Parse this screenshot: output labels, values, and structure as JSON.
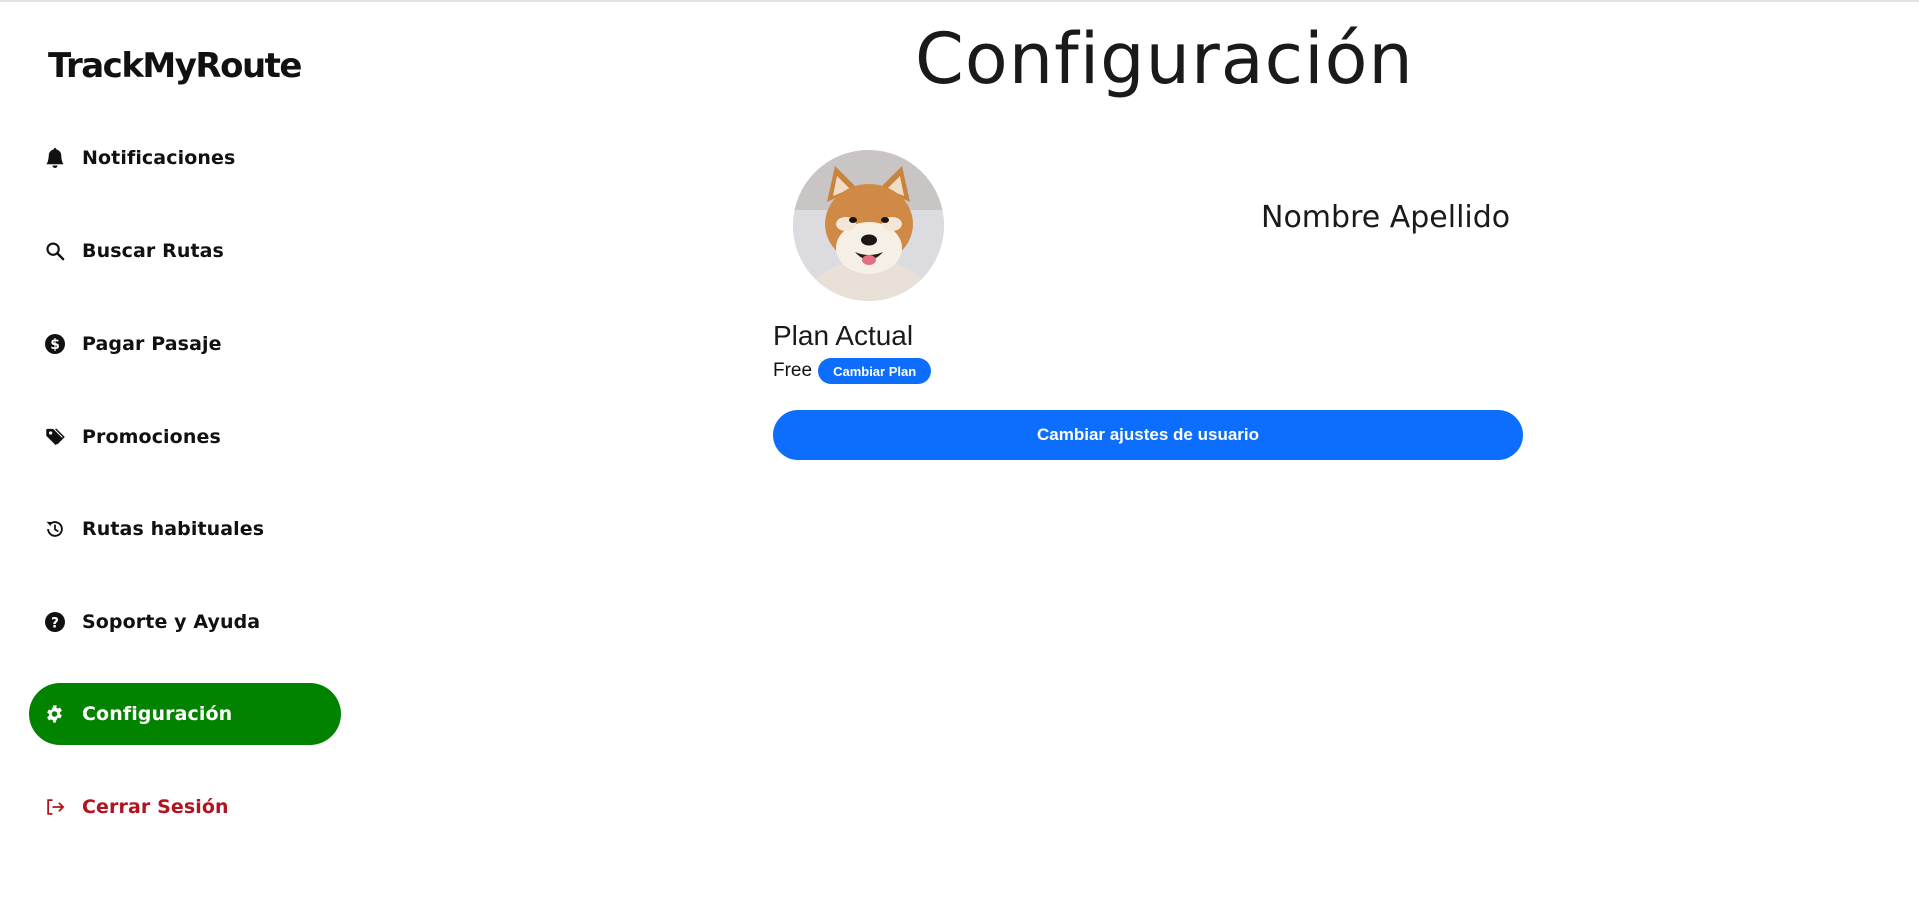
{
  "app": {
    "logo_text": "TrackMyRoute"
  },
  "sidebar": {
    "items": [
      {
        "label": "Notificaciones",
        "icon": "bell-icon"
      },
      {
        "label": "Buscar Rutas",
        "icon": "search-icon"
      },
      {
        "label": "Pagar Pasaje",
        "icon": "dollar-coin-icon"
      },
      {
        "label": "Promociones",
        "icon": "tags-icon"
      },
      {
        "label": "Rutas habituales",
        "icon": "history-icon"
      },
      {
        "label": "Soporte y Ayuda",
        "icon": "question-circle-icon"
      },
      {
        "label": "Configuración",
        "icon": "gear-icon",
        "active": true
      },
      {
        "label": "Cerrar Sesión",
        "icon": "logout-icon"
      }
    ]
  },
  "main": {
    "title": "Configuración",
    "profile": {
      "avatar_icon": "dog-avatar-photo",
      "name": "Nombre Apellido"
    },
    "plan": {
      "heading": "Plan Actual",
      "value": "Free",
      "change_plan_label": "Cambiar Plan"
    },
    "settings_button_label": "Cambiar ajustes de usuario"
  },
  "colors": {
    "active_nav": "#028300",
    "logout_text": "#b3121f",
    "primary_button": "#0d6efd"
  }
}
